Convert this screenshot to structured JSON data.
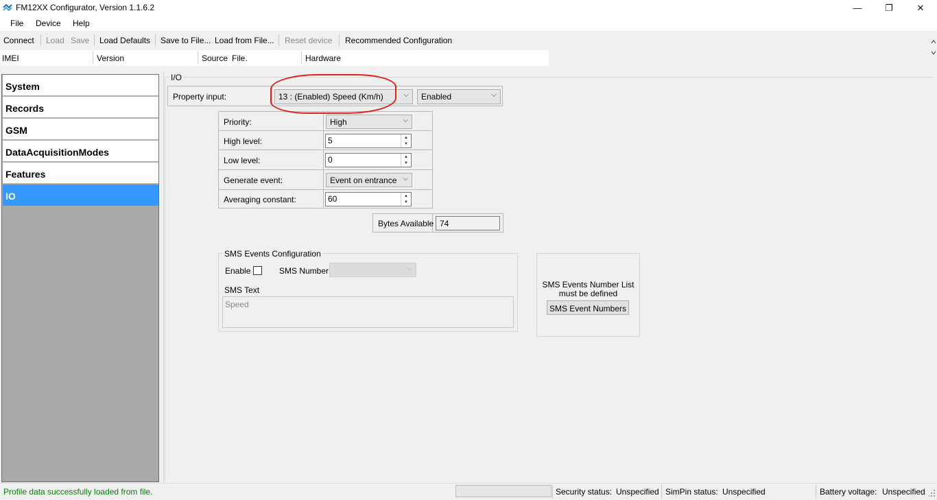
{
  "window": {
    "title": "FM12XX Configurator, Version 1.1.6.2",
    "controls": {
      "minimize": "—",
      "restore": "❐",
      "close": "✕"
    }
  },
  "menu": {
    "items": [
      "File",
      "Device",
      "Help"
    ]
  },
  "toolbar": {
    "connect": "Connect",
    "load": "Load",
    "save": "Save",
    "load_defaults": "Load Defaults",
    "save_to_file": "Save to File...",
    "load_from_file": "Load from File...",
    "reset_device": "Reset device",
    "recommended": "Recommended Configuration"
  },
  "info": {
    "imei_label": "IMEI",
    "version_label": "Version",
    "source_label": "Source",
    "source_value": "File.",
    "hardware_label": "Hardware"
  },
  "sidebar": {
    "items": [
      {
        "label": "System"
      },
      {
        "label": "Records"
      },
      {
        "label": "GSM"
      },
      {
        "label": "DataAcquisitionModes"
      },
      {
        "label": "Features"
      },
      {
        "label": "IO"
      }
    ],
    "active": "IO"
  },
  "io": {
    "group_title": "I/O",
    "property_input_label": "Property input:",
    "property_input_value": "13 : (Enabled) Speed (Km/h)",
    "enabled_value": "Enabled",
    "rows": {
      "priority_label": "Priority:",
      "priority_value": "High",
      "high_level_label": "High level:",
      "high_level_value": "5",
      "low_level_label": "Low level:",
      "low_level_value": "0",
      "generate_event_label": "Generate event:",
      "generate_event_value": "Event on entrance",
      "averaging_label": "Averaging constant:",
      "averaging_value": "60"
    },
    "bytes_available_label": "Bytes Available",
    "bytes_available_value": "74"
  },
  "sms": {
    "group_title": "SMS Events Configuration",
    "enable_label": "Enable",
    "number_label": "SMS Number",
    "text_label": "SMS Text",
    "text_value": "Speed",
    "list_note_line1": "SMS Events Number List",
    "list_note_line2": "must be defined",
    "numbers_button": "SMS Event Numbers"
  },
  "status": {
    "message": "Profile data successfully loaded from file.",
    "message_color": "#008000",
    "security_label": "Security status:",
    "security_value": "Unspecified",
    "simpin_label": "SimPin status:",
    "simpin_value": "Unspecified",
    "battery_label": "Battery voltage:",
    "battery_value": "Unspecified"
  },
  "colors": {
    "accent": "#3399ff",
    "annotation": "#e0201b"
  }
}
